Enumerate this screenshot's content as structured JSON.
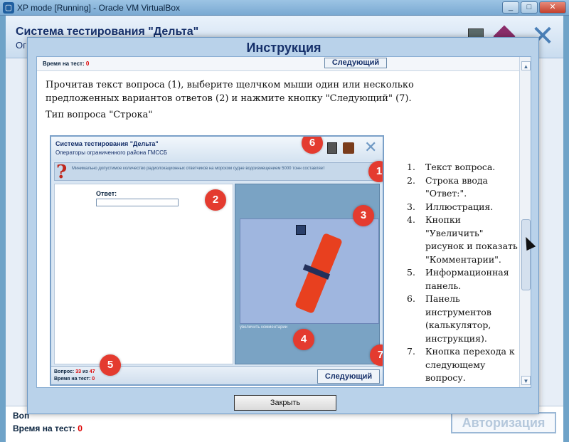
{
  "vbox": {
    "title": "XP mode [Running] - Oracle VM VirtualBox",
    "icon": "virtualbox-icon",
    "minimize": "_",
    "maximize": "□",
    "close": "✕"
  },
  "app": {
    "title": "Система тестирования \"Дельта\"",
    "subtitle": "Ог",
    "footer_question_label": "Воп",
    "footer_time_label": "Время на тест:",
    "footer_time_value": "0",
    "auth_button": "Авторизация",
    "close_x": "✕"
  },
  "modal": {
    "title": "Инструкция",
    "topstrip_time_label": "Время на тест:",
    "topstrip_time_value": "0",
    "topstrip_next": "Следующий",
    "instructions": "Прочитав текст вопроса (1), выберите щелчком мыши один или несколько предложенных вариантов ответов (2) и нажмите кнопку \"Следующий\" (7).",
    "question_type": "Тип вопроса \"Строка\"",
    "close_button": "Закрыть",
    "scroll_up": "▲",
    "scroll_down": "▼"
  },
  "illustration": {
    "title": "Система тестирования \"Дельта\"",
    "subtitle": "Операторы ограниченного района ГМССБ",
    "question_mark": "?",
    "question_text": "Минимально допустимое количество радиолокационных ответчиков на морском судне водоизмещением 5000 тонн составляет",
    "answer_label": "Ответ:",
    "image_toolbar": "увеличить   комментарии",
    "footer_question_label": "Вопрос:",
    "footer_question_current": "33",
    "footer_question_of": "из",
    "footer_question_total": "47",
    "footer_time_label": "Время на тест:",
    "footer_time_value": "0",
    "next_button": "Следующий",
    "close_x": "✕"
  },
  "badges": [
    "1",
    "2",
    "3",
    "4",
    "5",
    "6",
    "7"
  ],
  "legend": [
    {
      "n": "1.",
      "text": "Текст вопроса."
    },
    {
      "n": "2.",
      "text": "Строка ввода \"Ответ:\"."
    },
    {
      "n": "3.",
      "text": "Иллюстрация."
    },
    {
      "n": "4.",
      "text": "Кнопки \"Увеличить\" рисунок и показать \"Комментарии\"."
    },
    {
      "n": "5.",
      "text": "Информационная панель."
    },
    {
      "n": "6.",
      "text": "Панель инструментов (калькулятор, инструкция)."
    },
    {
      "n": "7.",
      "text": "Кнопка перехода к следующему вопросу."
    }
  ],
  "colors": {
    "accent_blue": "#16306a",
    "badge_red": "#e43b2f",
    "timer_red": "#d00000"
  }
}
